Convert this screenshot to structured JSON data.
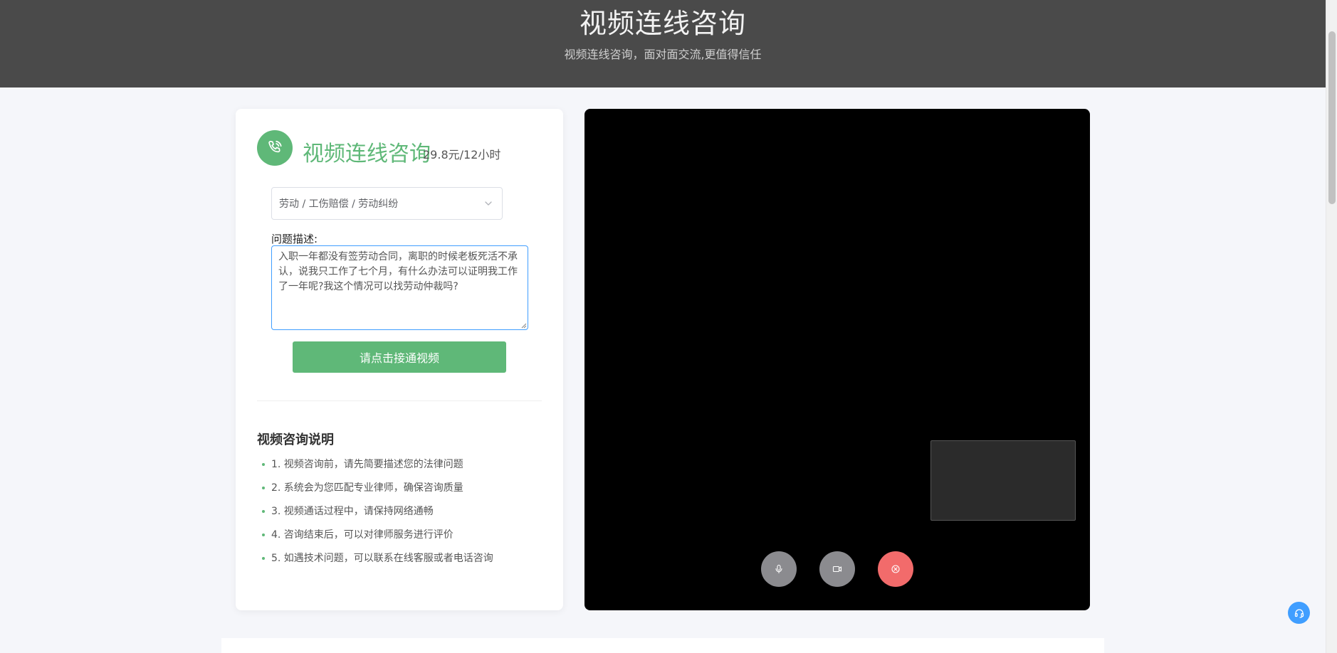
{
  "hero": {
    "title": "视频连线咨询",
    "subtitle": "视频连线咨询，面对面交流,更值得信任"
  },
  "service": {
    "icon": "phone-icon",
    "title": "视频连线咨询",
    "price": "29.8元/12小时"
  },
  "form": {
    "category_value": "劳动 / 工伤赔偿 / 劳动纠纷",
    "description_label": "问题描述:",
    "description_value": "入职一年都没有签劳动合同，离职的时候老板死活不承认，说我只工作了七个月，有什么办法可以证明我工作了一年呢?我这个情况可以找劳动仲裁吗?",
    "connect_button": "请点击接通视频"
  },
  "notes": {
    "title": "视频咨询说明",
    "items": [
      "1. 视频咨询前，请先简要描述您的法律问题",
      "2. 系统会为您匹配专业律师，确保咨询质量",
      "3. 视频通话过程中，请保持网络通畅",
      "4. 咨询结束后，可以对律师服务进行评价",
      "5. 如遇技术问题，可以联系在线客服或者电话咨询"
    ]
  },
  "video_controls": {
    "mic_icon": "microphone-icon",
    "camera_icon": "camera-icon",
    "hangup_icon": "hang-up-icon"
  },
  "colors": {
    "accent": "#5fb878",
    "header_bg": "#4a4a4a",
    "hangup": "#f26b6b",
    "control": "#8b8b8f",
    "help": "#409eff"
  }
}
